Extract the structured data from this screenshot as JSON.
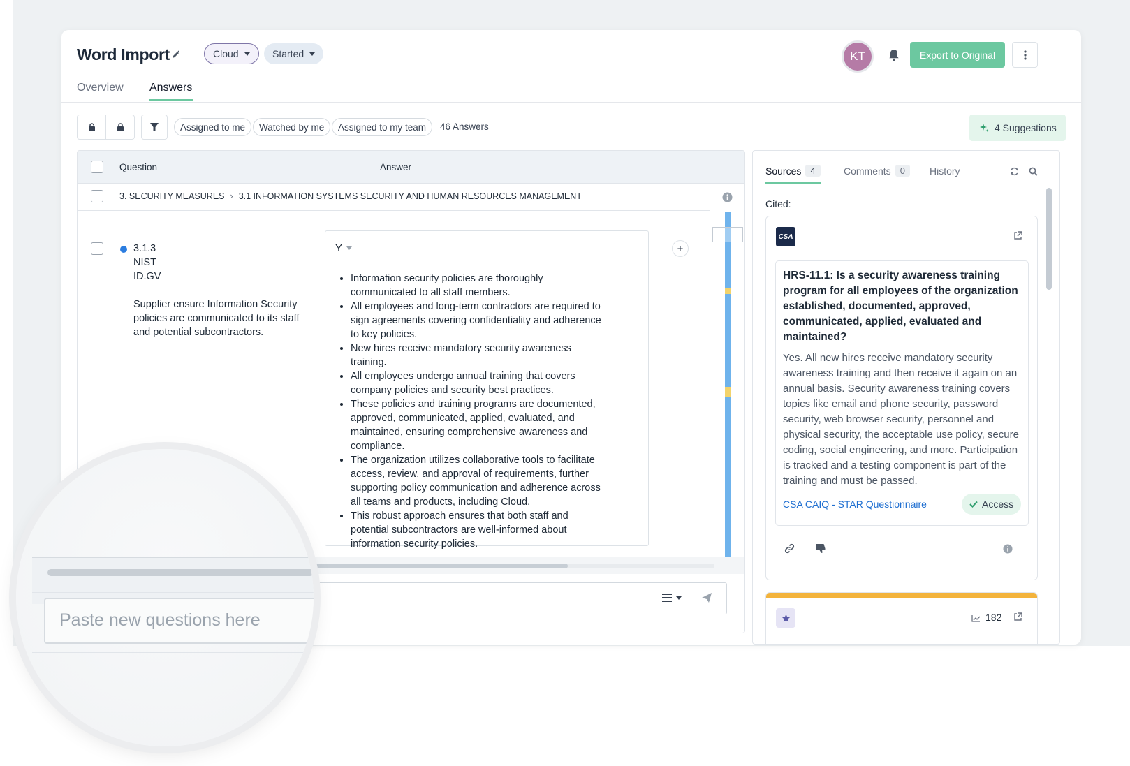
{
  "header": {
    "title": "Word Import",
    "tags": [
      {
        "label": "Cloud"
      },
      {
        "label": "Started"
      }
    ],
    "avatar_initials": "KT",
    "export_label": "Export to Original",
    "tabs": [
      {
        "label": "Overview",
        "active": false
      },
      {
        "label": "Answers",
        "active": true
      }
    ]
  },
  "toolbar": {
    "filters": [
      "Assigned to me",
      "Watched by me",
      "Assigned to my team"
    ],
    "answer_count": "46 Answers",
    "suggestions_label": "4 Suggestions"
  },
  "table": {
    "col_question": "Question",
    "col_answer": "Answer",
    "breadcrumb": [
      "3. SECURITY MEASURES",
      "3.1 INFORMATION SYSTEMS SECURITY AND HUMAN RESOURCES MANAGEMENT"
    ],
    "row": {
      "id": "3.1.3",
      "ref1": "NIST",
      "ref2": "ID.GV",
      "question": "Supplier ensure Information Security policies are communicated to its staff and potential subcontractors.",
      "answer_value": "Y",
      "answer_bullets": [
        "Information security policies are thoroughly communicated to all staff members.",
        "All employees and long-term contractors are required to sign agreements covering confidentiality and adherence to key policies.",
        "New hires receive mandatory security awareness training.",
        "All employees undergo annual training that covers company policies and security best practices.",
        "These policies and training programs are documented, approved, communicated, applied, evaluated, and maintained, ensuring comprehensive awareness and compliance.",
        "The organization utilizes collaborative tools to facilitate access, review, and approval of requirements, further supporting policy communication and adherence across all teams and products, including Cloud.",
        "This robust approach ensures that both staff and potential subcontractors are well-informed about information security policies."
      ]
    },
    "paste_placeholder": "Paste new questions here"
  },
  "sources": {
    "tabs": [
      {
        "label": "Sources",
        "count": "4",
        "active": true
      },
      {
        "label": "Comments",
        "count": "0",
        "active": false
      },
      {
        "label": "History",
        "count": "",
        "active": false
      }
    ],
    "cited_label": "Cited:",
    "card": {
      "logo": "CSA",
      "question": "HRS-11.1: Is a security awareness training program for all employees of the organization established, documented, approved, communicated, applied, evaluated and maintained?",
      "answer": "Yes. All new hires receive mandatory security awareness training and then receive it again on an annual basis. Security awareness training covers topics like email and phone security, password security, web browser security, personnel and physical security, the acceptable use policy, secure coding, social engineering, and more. Participation is tracked and a testing component is part of the training and must be passed.",
      "source_link": "CSA CAIQ - STAR Questionnaire",
      "access_label": "Access"
    },
    "second_card": {
      "views": "182"
    }
  },
  "colors": {
    "accent_green": "#6cc8a0",
    "link_blue": "#1f6fd1",
    "dot_blue": "#2b7de0",
    "orange": "#f3b33c"
  }
}
